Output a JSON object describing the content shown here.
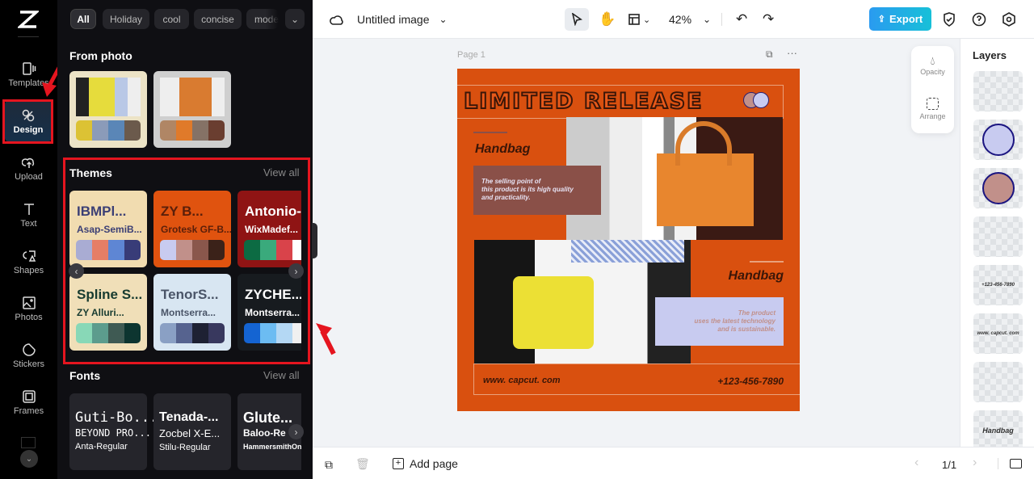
{
  "nav": {
    "items": [
      {
        "label": "Templates",
        "icon": "template-icon"
      },
      {
        "label": "Design",
        "icon": "design-icon"
      },
      {
        "label": "Upload",
        "icon": "upload-icon"
      },
      {
        "label": "Text",
        "icon": "text-icon"
      },
      {
        "label": "Shapes",
        "icon": "shapes-icon"
      },
      {
        "label": "Photos",
        "icon": "photos-icon"
      },
      {
        "label": "Stickers",
        "icon": "stickers-icon"
      },
      {
        "label": "Frames",
        "icon": "frames-icon"
      }
    ]
  },
  "panel": {
    "chips": [
      "All",
      "Holiday",
      "cool",
      "concise",
      "mode"
    ],
    "from_photo": {
      "title": "From photo",
      "cards": [
        {
          "palette": [
            "#dcc234",
            "#8b9bb9",
            "#5a86b7",
            "#6b5a4c"
          ]
        },
        {
          "palette": [
            "#b08665",
            "#e07a2a",
            "#857266",
            "#6a3e30"
          ]
        }
      ]
    },
    "themes": {
      "title": "Themes",
      "view_all": "View all",
      "cards": [
        {
          "t1": "IBMPl...",
          "t2": "Asap-SemiB...",
          "bg": "#f1dcb0",
          "fg": "#3b3f75",
          "palette": [
            "#a9acd3",
            "#e57e66",
            "#5e86d4",
            "#383c78"
          ]
        },
        {
          "t1": "ZY B...",
          "t2": "Grotesk GF-B...",
          "bg": "#e0530f",
          "fg": "#5a1f0a",
          "palette": [
            "#c8cbf0",
            "#c1908a",
            "#8a574c",
            "#3b2219"
          ]
        },
        {
          "t1": "Antonio-Bol",
          "t2": "WixMadef...",
          "bg": "#8f1414",
          "fg": "#ffffff",
          "palette": [
            "#0c6b43",
            "#3aaa7c",
            "#d9434a",
            "#ffffff"
          ]
        },
        {
          "t1": "Spline S...",
          "t2": "ZY Alluri...",
          "bg": "#f0dfb8",
          "fg": "#173b30",
          "palette": [
            "#88d8b7",
            "#5c9c8d",
            "#3f5a53",
            "#0d3530"
          ]
        },
        {
          "t1": "TenorS...",
          "t2": "Montserra...",
          "bg": "#d8e6f2",
          "fg": "#4a5568",
          "palette": [
            "#8aa0c4",
            "#56638f",
            "#1e2133",
            "#38385e"
          ]
        },
        {
          "t1": "ZYCHE...",
          "t2": "Montserra...",
          "bg": "#171b1f",
          "fg": "#ffffff",
          "palette": [
            "#1464d2",
            "#6cbcf2",
            "#b4d8f4",
            "#f0f0f0"
          ]
        }
      ]
    },
    "fonts": {
      "title": "Fonts",
      "view_all": "View all",
      "cards": [
        [
          "Guti-Bo...",
          "BEYOND PRO...",
          "Anta-Regular"
        ],
        [
          "Tenada-...",
          "Zocbel X-E...",
          "Stilu-Regular"
        ],
        [
          "Glute...",
          "Baloo-Re",
          "HammersmithOn..."
        ]
      ]
    }
  },
  "topbar": {
    "title": "Untitled image",
    "zoom": "42%",
    "export": "Export"
  },
  "canvas": {
    "page_label": "Page 1",
    "tools": [
      {
        "label": "Opacity"
      },
      {
        "label": "Arrange"
      }
    ]
  },
  "design": {
    "headline": "LIMITED RELEASE",
    "heading1": "Handbag",
    "body1": "The selling point of\nthis product is its high quality\nand practicality.",
    "heading2": "Handbag",
    "body2": "The product\nuses the latest technology\nand is sustainable.",
    "website": "www. capcut. com",
    "phone": "+123-456-7890"
  },
  "layers": {
    "title": "Layers",
    "items": [
      "",
      "",
      "",
      "",
      "+123-456-7890",
      "www. capcut. com",
      "",
      "Handbag"
    ]
  },
  "bottombar": {
    "add_page": "Add page",
    "page_count": "1/1"
  },
  "colors": {
    "accent": "#1fa8e8",
    "design_bg": "#d9500f",
    "annotation": "#e5151f"
  }
}
